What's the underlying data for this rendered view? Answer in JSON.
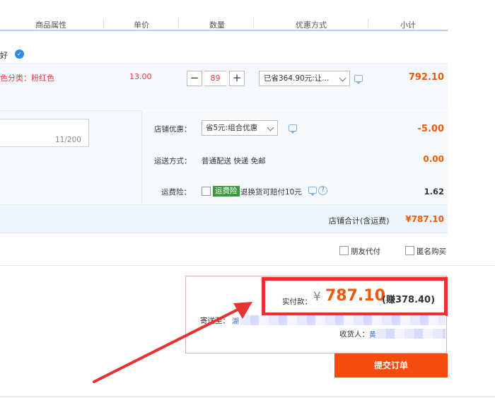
{
  "header": {
    "col_props": "商品属性",
    "col_price": "单价",
    "col_qty": "数量",
    "col_discount": "优惠方式",
    "col_subtotal": "小计"
  },
  "shop": {
    "name_tail": "好"
  },
  "item": {
    "props": "色分类：粉红色",
    "price": "13.00",
    "qty_minus": "−",
    "qty": "89",
    "qty_plus": "+",
    "discount": "已省364.90元:让...",
    "subtotal": "792.10"
  },
  "options": {
    "memo_count": "11/200",
    "shop_discount_label": "店铺优惠：",
    "shop_discount_value": "省5元:组合优惠",
    "shop_discount_amount": "-5.00",
    "shipping_label": "运送方式：",
    "shipping_value": "普通配送 快递 免邮",
    "shipping_amount": "0.00",
    "insurance_label": "运费险：",
    "insurance_tag": "运费险",
    "insurance_text": "退换货可赔付10元",
    "insurance_help": "?",
    "insurance_amount": "1.62"
  },
  "shop_total": {
    "label": "店铺合计(含运费)",
    "value": "¥787.10"
  },
  "extras": {
    "friend_pay": "朋友代付",
    "anonymous": "匿名购买"
  },
  "summary": {
    "pay_label": "实付款：",
    "currency": "¥",
    "pay_value": "787.10",
    "earn": "(赚378.40)",
    "addr_label": "寄送至：",
    "addr_value": "湖",
    "receiver_label": "收货人：",
    "receiver_value": "黄"
  },
  "submit_label": "提交订单",
  "colors": {
    "accent": "#f25807",
    "submit_bg": "#f44b0f",
    "highlight": "#e63232",
    "link": "#2e6bd6"
  }
}
